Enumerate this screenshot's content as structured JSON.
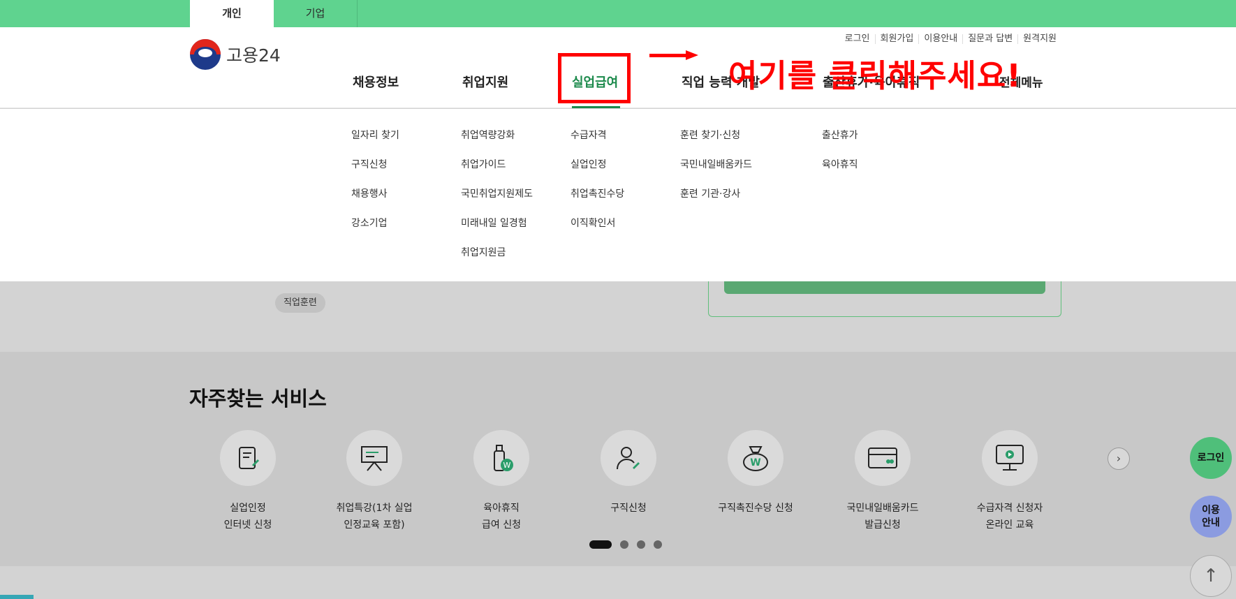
{
  "top_tabs": [
    {
      "label": "개인",
      "active": true
    },
    {
      "label": "기업",
      "active": false
    }
  ],
  "util_links": [
    "로그인",
    "회원가입",
    "이용안내",
    "질문과 답변",
    "원격지원"
  ],
  "logo": {
    "text": "고용24"
  },
  "gnb": [
    {
      "label": "채용정보"
    },
    {
      "label": "취업지원"
    },
    {
      "label": "실업급여",
      "active": true
    },
    {
      "label": "직업 능력 개발"
    },
    {
      "label": "출산휴가·육아휴직"
    }
  ],
  "all_menu_label": "전체메뉴",
  "annotation": {
    "text": "여기를 클릭해주세요!",
    "color": "#ff0000"
  },
  "dropdown": {
    "col1": [
      "일자리 찾기",
      "구직신청",
      "채용행사",
      "강소기업"
    ],
    "col2": [
      "취업역량강화",
      "취업가이드",
      "국민취업지원제도",
      "미래내일 일경험",
      "취업지원금"
    ],
    "col3": [
      "수급자격",
      "실업인정",
      "취업촉진수당",
      "이직확인서"
    ],
    "col4": [
      "훈련 찾기·신청",
      "국민내일배움카드",
      "훈련 기관·강사"
    ],
    "col5": [
      "출산휴가",
      "육아휴직"
    ]
  },
  "chip_label": "직업훈련",
  "services": {
    "title": "자주찾는 서비스",
    "items": [
      {
        "label": "실업인정\n인터넷 신청",
        "icon": "document-pen-icon"
      },
      {
        "label": "취업특강(1차 실업\n인정교육 포함)",
        "icon": "presentation-board-icon"
      },
      {
        "label": "육아휴직\n급여 신청",
        "icon": "baby-bottle-won-icon"
      },
      {
        "label": "구직신청",
        "icon": "person-pen-icon"
      },
      {
        "label": "구직촉진수당 신청",
        "icon": "money-bag-icon"
      },
      {
        "label": "국민내일배움카드\n발급신청",
        "icon": "card-icon"
      },
      {
        "label": "수급자격 신청자\n온라인 교육",
        "icon": "monitor-play-icon"
      }
    ],
    "page_count": 4,
    "current_page": 1
  },
  "floating": {
    "login_label": "로그인",
    "guide_label": "이용\n안내"
  },
  "colors": {
    "brand_green": "#5fd38f",
    "active_green": "#1c8a4c",
    "highlight_red": "#ff0000"
  }
}
